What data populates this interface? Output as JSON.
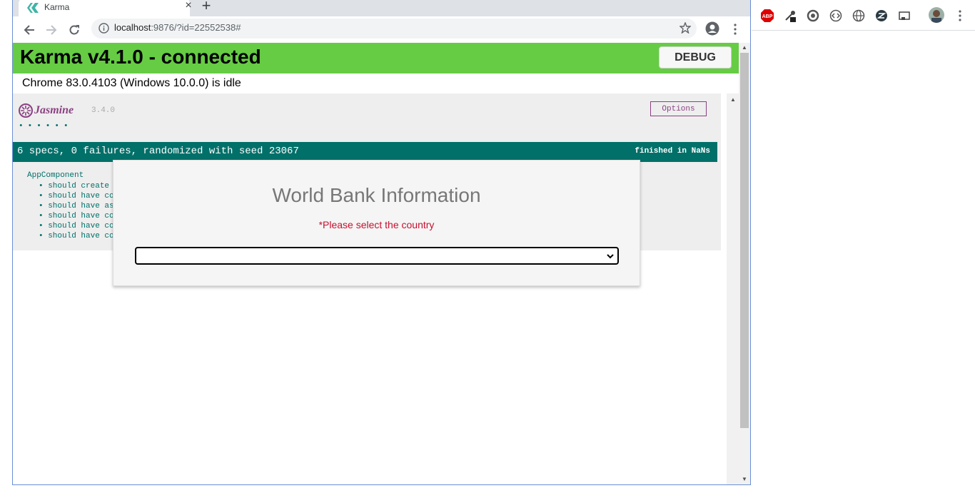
{
  "browser": {
    "tab_title": "Karma",
    "url_host": "localhost",
    "url_rest": ":9876/?id=22552538#"
  },
  "extensions": [
    "abp-icon",
    "eyedropper-icon",
    "refresh-circle-icon",
    "code-icon",
    "globe-icon",
    "z-icon",
    "cast-icon",
    "avatar",
    "kebab-icon"
  ],
  "extension_abp_label": "ABP",
  "karma": {
    "banner_title": "Karma v4.1.0 - connected",
    "debug_label": "DEBUG",
    "status": "Chrome 83.0.4103 (Windows 10.0.0) is idle",
    "banner_color": "#66cc44"
  },
  "jasmine": {
    "logo_text": "Jasmine",
    "version": "3.4.0",
    "dots": "••••••",
    "options_label": "Options",
    "summary": "6 specs, 0 failures, randomized with seed 23067",
    "finished": "finished in NaNs",
    "suite": "AppComponent",
    "specs": [
      "should create",
      "should have co",
      "should have as",
      "should have co",
      "should have co",
      "should have co"
    ],
    "accent_color": "#007069"
  },
  "app": {
    "title": "World Bank Information",
    "hint": "*Please select the country",
    "selected_country": "",
    "hint_color": "#c8102e"
  }
}
